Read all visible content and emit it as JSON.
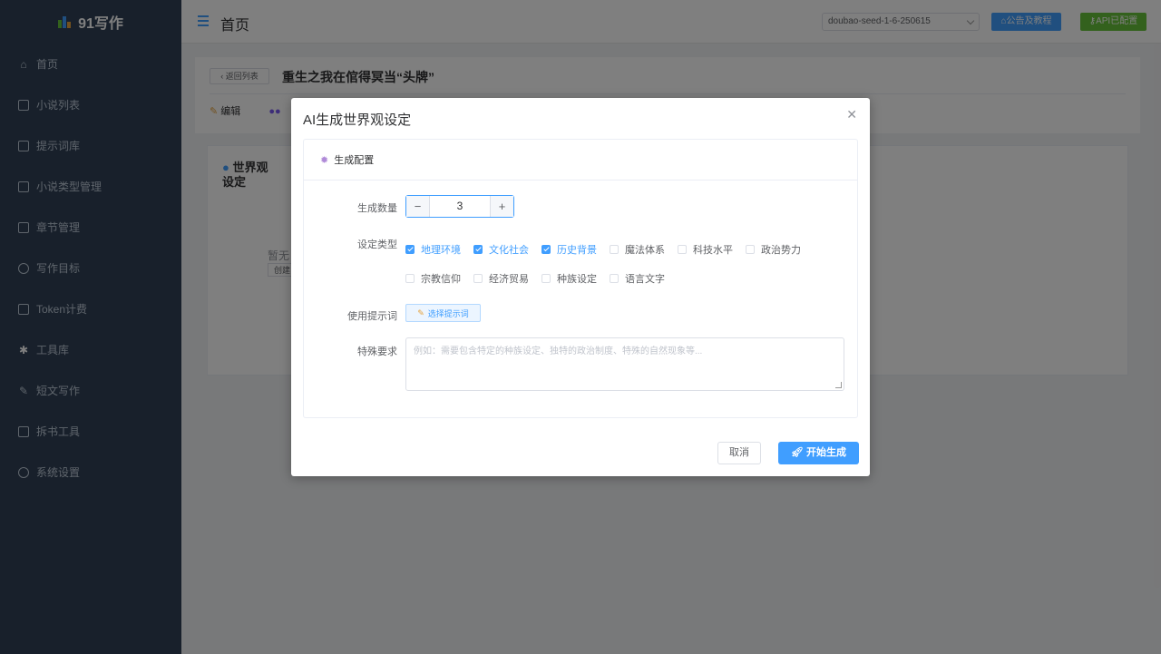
{
  "app": {
    "brand": "91写作"
  },
  "sidebar": {
    "items": [
      {
        "label": "首页",
        "icon": "home-icon"
      },
      {
        "label": "小说列表",
        "icon": "document-icon"
      },
      {
        "label": "提示词库",
        "icon": "chat-icon"
      },
      {
        "label": "小说类型管理",
        "icon": "save-icon"
      },
      {
        "label": "章节管理",
        "icon": "book-icon"
      },
      {
        "label": "写作目标",
        "icon": "target-icon"
      },
      {
        "label": "Token计费",
        "icon": "credit-card-icon"
      },
      {
        "label": "工具库",
        "icon": "gear-icon"
      },
      {
        "label": "短文写作",
        "icon": "pen-icon"
      },
      {
        "label": "拆书工具",
        "icon": "monitor-icon"
      },
      {
        "label": "系统设置",
        "icon": "settings-icon"
      }
    ]
  },
  "header": {
    "title": "首页",
    "model": "doubao-seed-1-6-250615",
    "notice_button": "公告及教程",
    "api_button": "API已配置"
  },
  "novel": {
    "back_label": "返回列表",
    "title": "重生之我在倌得冥当“头牌”",
    "tab_edit": "编辑",
    "panel_title_1": "世界观",
    "panel_title_2": "设定",
    "empty_text": "暂无",
    "create_label": "创建"
  },
  "dialog": {
    "title": "AI生成世界观设定",
    "section_title": "生成配置",
    "count_label": "生成数量",
    "count_value": "3",
    "type_label": "设定类型",
    "types": [
      {
        "label": "地理环境",
        "checked": true
      },
      {
        "label": "文化社会",
        "checked": true
      },
      {
        "label": "历史背景",
        "checked": true
      },
      {
        "label": "魔法体系",
        "checked": false
      },
      {
        "label": "科技水平",
        "checked": false
      },
      {
        "label": "政治势力",
        "checked": false
      },
      {
        "label": "宗教信仰",
        "checked": false
      },
      {
        "label": "经济贸易",
        "checked": false
      },
      {
        "label": "种族设定",
        "checked": false
      },
      {
        "label": "语言文字",
        "checked": false
      }
    ],
    "prompt_label": "使用提示词",
    "prompt_button": "选择提示词",
    "special_label": "特殊要求",
    "special_placeholder": "例如：需要包含特定的种族设定、独特的政治制度、特殊的自然现象等...",
    "cancel": "取消",
    "start": "开始生成"
  },
  "colors": {
    "primary": "#409eff",
    "success": "#67c23a",
    "sidebar": "#304156"
  }
}
